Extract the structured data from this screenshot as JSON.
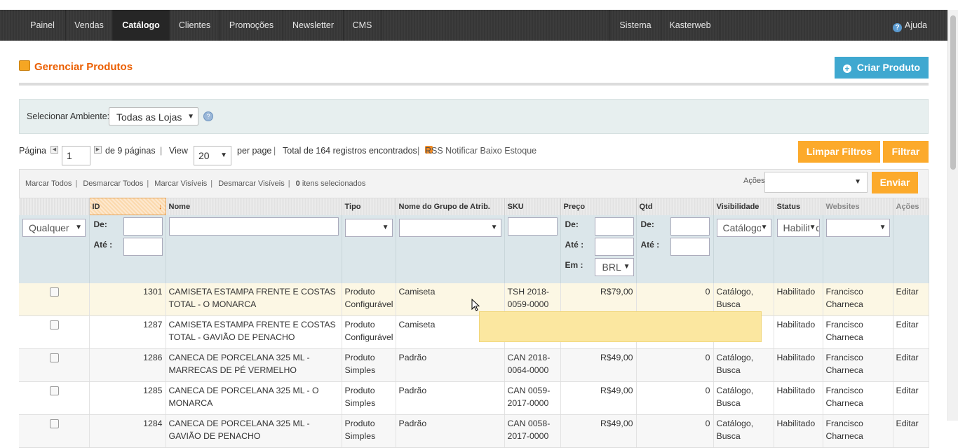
{
  "nav": {
    "items": [
      "Painel",
      "Vendas",
      "Catálogo",
      "Clientes",
      "Promoções",
      "Newsletter",
      "CMS"
    ],
    "right_items": [
      "Sistema",
      "Kasterweb"
    ],
    "help": "Ajuda"
  },
  "page": {
    "title": "Gerenciar Produtos",
    "create_button": "Criar Produto"
  },
  "store_switcher": {
    "label": "Selecionar Ambiente:",
    "value": "Todas as Lojas"
  },
  "pager": {
    "page_label": "Página",
    "page_value": "1",
    "of_pages": "de 9 páginas",
    "view_label": "View",
    "per_page_value": "20",
    "per_page_label": "per page",
    "total": "Total de 164 registros encontrados",
    "rss": "RSS Notificar Baixo Estoque"
  },
  "buttons": {
    "clear_filters": "Limpar Filtros",
    "filter": "Filtrar",
    "submit": "Enviar"
  },
  "massaction": {
    "select_all": "Marcar Todos",
    "unselect_all": "Desmarcar Todos",
    "select_visible": "Marcar Visíveis",
    "unselect_visible": "Desmarcar Visíveis",
    "selected_count": "0",
    "selected_label": "itens selecionados",
    "actions_label": "Ações"
  },
  "columns": [
    "ID",
    "Nome",
    "Tipo",
    "Nome do Grupo de Atrib.",
    "SKU",
    "Preço",
    "Qtd",
    "Visibilidade",
    "Status",
    "Websites",
    "Ações"
  ],
  "filters": {
    "any": "Qualquer",
    "from": "De:",
    "to": "Até :",
    "in": "Em :",
    "currency": "BRL",
    "visibility": "Catálogo",
    "status": "Habilitado"
  },
  "rows": [
    {
      "id": "1301",
      "name": "CAMISETA ESTAMPA FRENTE E COSTAS TOTAL - O MONARCA",
      "type": "Produto Configurável",
      "set": "Camiseta",
      "sku": "TSH 2018-0059-0000",
      "price": "R$79,00",
      "qty": "0",
      "visibility": "Catálogo, Busca",
      "status": "Habilitado",
      "website": "Francisco Charneca",
      "action": "Editar"
    },
    {
      "id": "1287",
      "name": "CAMISETA ESTAMPA FRENTE E COSTAS TOTAL - GAVIÃO DE PENACHO",
      "type": "Produto Configurável",
      "set": "Camiseta",
      "sku": "",
      "price": "",
      "qty": "",
      "visibility": "",
      "status": "Habilitado",
      "website": "Francisco Charneca",
      "action": "Editar"
    },
    {
      "id": "1286",
      "name": "CANECA DE PORCELANA 325 ML - MARRECAS DE PÉ VERMELHO",
      "type": "Produto Simples",
      "set": "Padrão",
      "sku": "CAN 2018-0064-0000",
      "price": "R$49,00",
      "qty": "0",
      "visibility": "Catálogo, Busca",
      "status": "Habilitado",
      "website": "Francisco Charneca",
      "action": "Editar"
    },
    {
      "id": "1285",
      "name": "CANECA DE PORCELANA 325 ML - O MONARCA",
      "type": "Produto Simples",
      "set": "Padrão",
      "sku": "CAN 0059-2017-0000",
      "price": "R$49,00",
      "qty": "0",
      "visibility": "Catálogo, Busca",
      "status": "Habilitado",
      "website": "Francisco Charneca",
      "action": "Editar"
    },
    {
      "id": "1284",
      "name": "CANECA DE PORCELANA 325 ML - GAVIÃO DE PENACHO",
      "type": "Produto Simples",
      "set": "Padrão",
      "sku": "CAN 0058-2017-0000",
      "price": "R$49,00",
      "qty": "0",
      "visibility": "Catálogo, Busca",
      "status": "Habilitado",
      "website": "Francisco Charneca",
      "action": "Editar"
    }
  ]
}
